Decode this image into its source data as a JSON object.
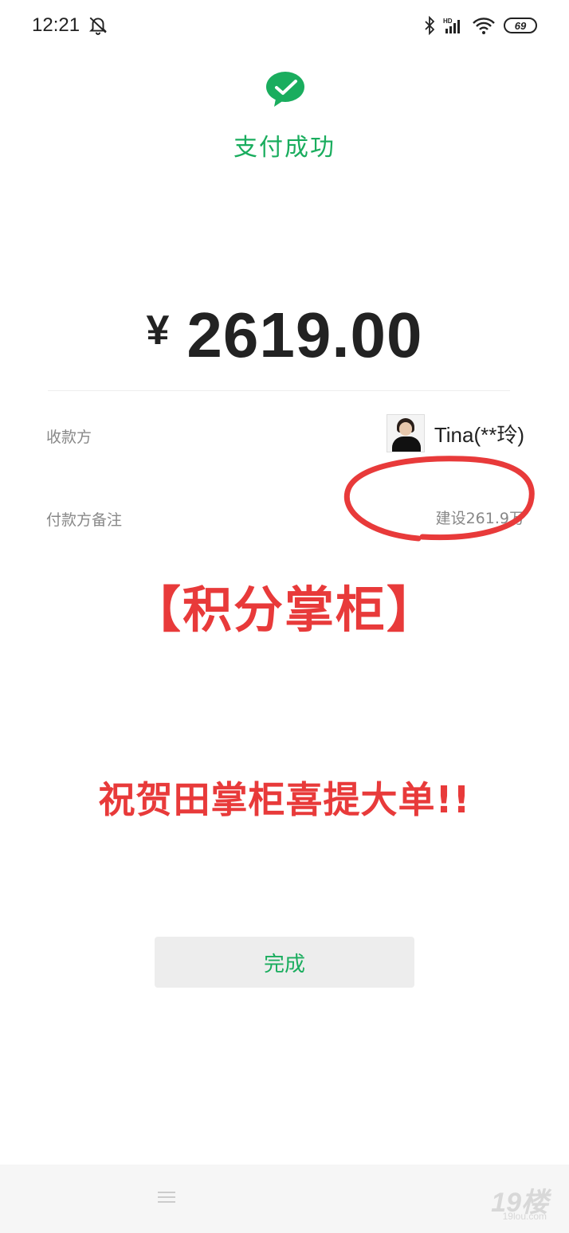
{
  "statusbar": {
    "time": "12:21",
    "network": "HD",
    "battery": "69"
  },
  "payment": {
    "status": "支付成功",
    "currency": "¥",
    "amount": "2619.00",
    "payee_label": "收款方",
    "payee_name": "Tina(**玲)",
    "note_label": "付款方备注",
    "note_value": "建设261.9万"
  },
  "overlay": {
    "brand": "【积分掌柜】",
    "message": "祝贺田掌柜喜提大单!!"
  },
  "actions": {
    "done_label": "完成"
  },
  "watermark": {
    "main": "19楼",
    "sub": "19lou.com"
  },
  "colors": {
    "accent": "#1aad5e",
    "annotation": "#e83a3a"
  }
}
